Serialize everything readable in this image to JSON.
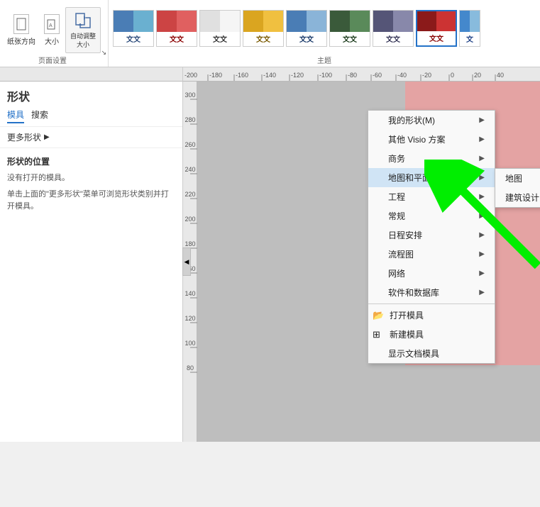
{
  "ribbon": {
    "page_setup_label": "页面设置",
    "expand_icon": "↘",
    "buttons": {
      "paper_direction": "纸张方向",
      "size": "大小",
      "auto_adjust": "自动调整\n大小"
    },
    "themes_label": "主题",
    "themes": [
      {
        "label": "文文",
        "color1": "#4a7db5",
        "color2": "#6ab0d0",
        "text_color": "#2a4a7a"
      },
      {
        "label": "文文",
        "color1": "#cc4444",
        "color2": "#e06060",
        "text_color": "#8b0000"
      },
      {
        "label": "文文",
        "color1": "#f0f0f0",
        "color2": "#ffffff",
        "text_color": "#333333"
      },
      {
        "label": "文文",
        "color1": "#daa520",
        "color2": "#f0c040",
        "text_color": "#7a5a00"
      },
      {
        "label": "文文",
        "color1": "#4a7db5",
        "color2": "#8ab4d8",
        "text_color": "#1a3a6a"
      },
      {
        "label": "文文",
        "color1": "#3a5a3a",
        "color2": "#5a8a5a",
        "text_color": "#1a3a1a"
      },
      {
        "label": "文文",
        "color1": "#555577",
        "color2": "#8888aa",
        "text_color": "#333355"
      },
      {
        "label": "文文",
        "color1": "#cc3333",
        "color2": "#dd6666",
        "text_color": "#880000",
        "selected": true
      },
      {
        "label": "文",
        "color1": "#4488cc",
        "color2": "#88bbdd",
        "text_color": "#224488"
      }
    ]
  },
  "ruler": {
    "marks": [
      "-200",
      "-180",
      "-160",
      "-140",
      "-120",
      "-100",
      "-80",
      "-60",
      "-40",
      "-20",
      "0",
      "20",
      "40"
    ],
    "v_marks": [
      "300",
      "280",
      "260",
      "240",
      "220",
      "200",
      "180",
      "160",
      "140",
      "120",
      "100",
      "80"
    ]
  },
  "left_panel": {
    "title": "形状",
    "tabs": [
      "模具",
      "搜索"
    ],
    "more_shapes": "更多形状",
    "location_title": "形状的位置",
    "no_model": "没有打开的模具。",
    "hint": "单击上面的\"更多形状\"菜单可浏览形状类别并打开模具。"
  },
  "context_menu": {
    "items": [
      {
        "label": "我的形状(M)",
        "has_arrow": true,
        "icon": null
      },
      {
        "label": "其他 Visio 方案",
        "has_arrow": true,
        "icon": null
      },
      {
        "label": "商务",
        "has_arrow": true,
        "icon": null
      },
      {
        "label": "地图和平面布置图",
        "has_arrow": true,
        "icon": null,
        "hovered": true
      },
      {
        "label": "工程",
        "has_arrow": true,
        "icon": null
      },
      {
        "label": "常规",
        "has_arrow": true,
        "icon": null
      },
      {
        "label": "日程安排",
        "has_arrow": true,
        "icon": null
      },
      {
        "label": "流程图",
        "has_arrow": true,
        "icon": null
      },
      {
        "label": "网络",
        "has_arrow": true,
        "icon": null
      },
      {
        "label": "软件和数据库",
        "has_arrow": true,
        "icon": null
      }
    ],
    "separator_items": [
      {
        "label": "打开模具",
        "has_arrow": false,
        "icon": "open"
      },
      {
        "label": "新建模具",
        "has_arrow": false,
        "icon": "new"
      },
      {
        "label": "显示文档模具",
        "has_arrow": false,
        "icon": null
      }
    ],
    "submenu": {
      "items": [
        {
          "label": "地图",
          "has_arrow": true
        },
        {
          "label": "建筑设计图",
          "has_arrow": true
        }
      ]
    }
  },
  "annotation": {
    "arrow_color": "#00ee00"
  }
}
